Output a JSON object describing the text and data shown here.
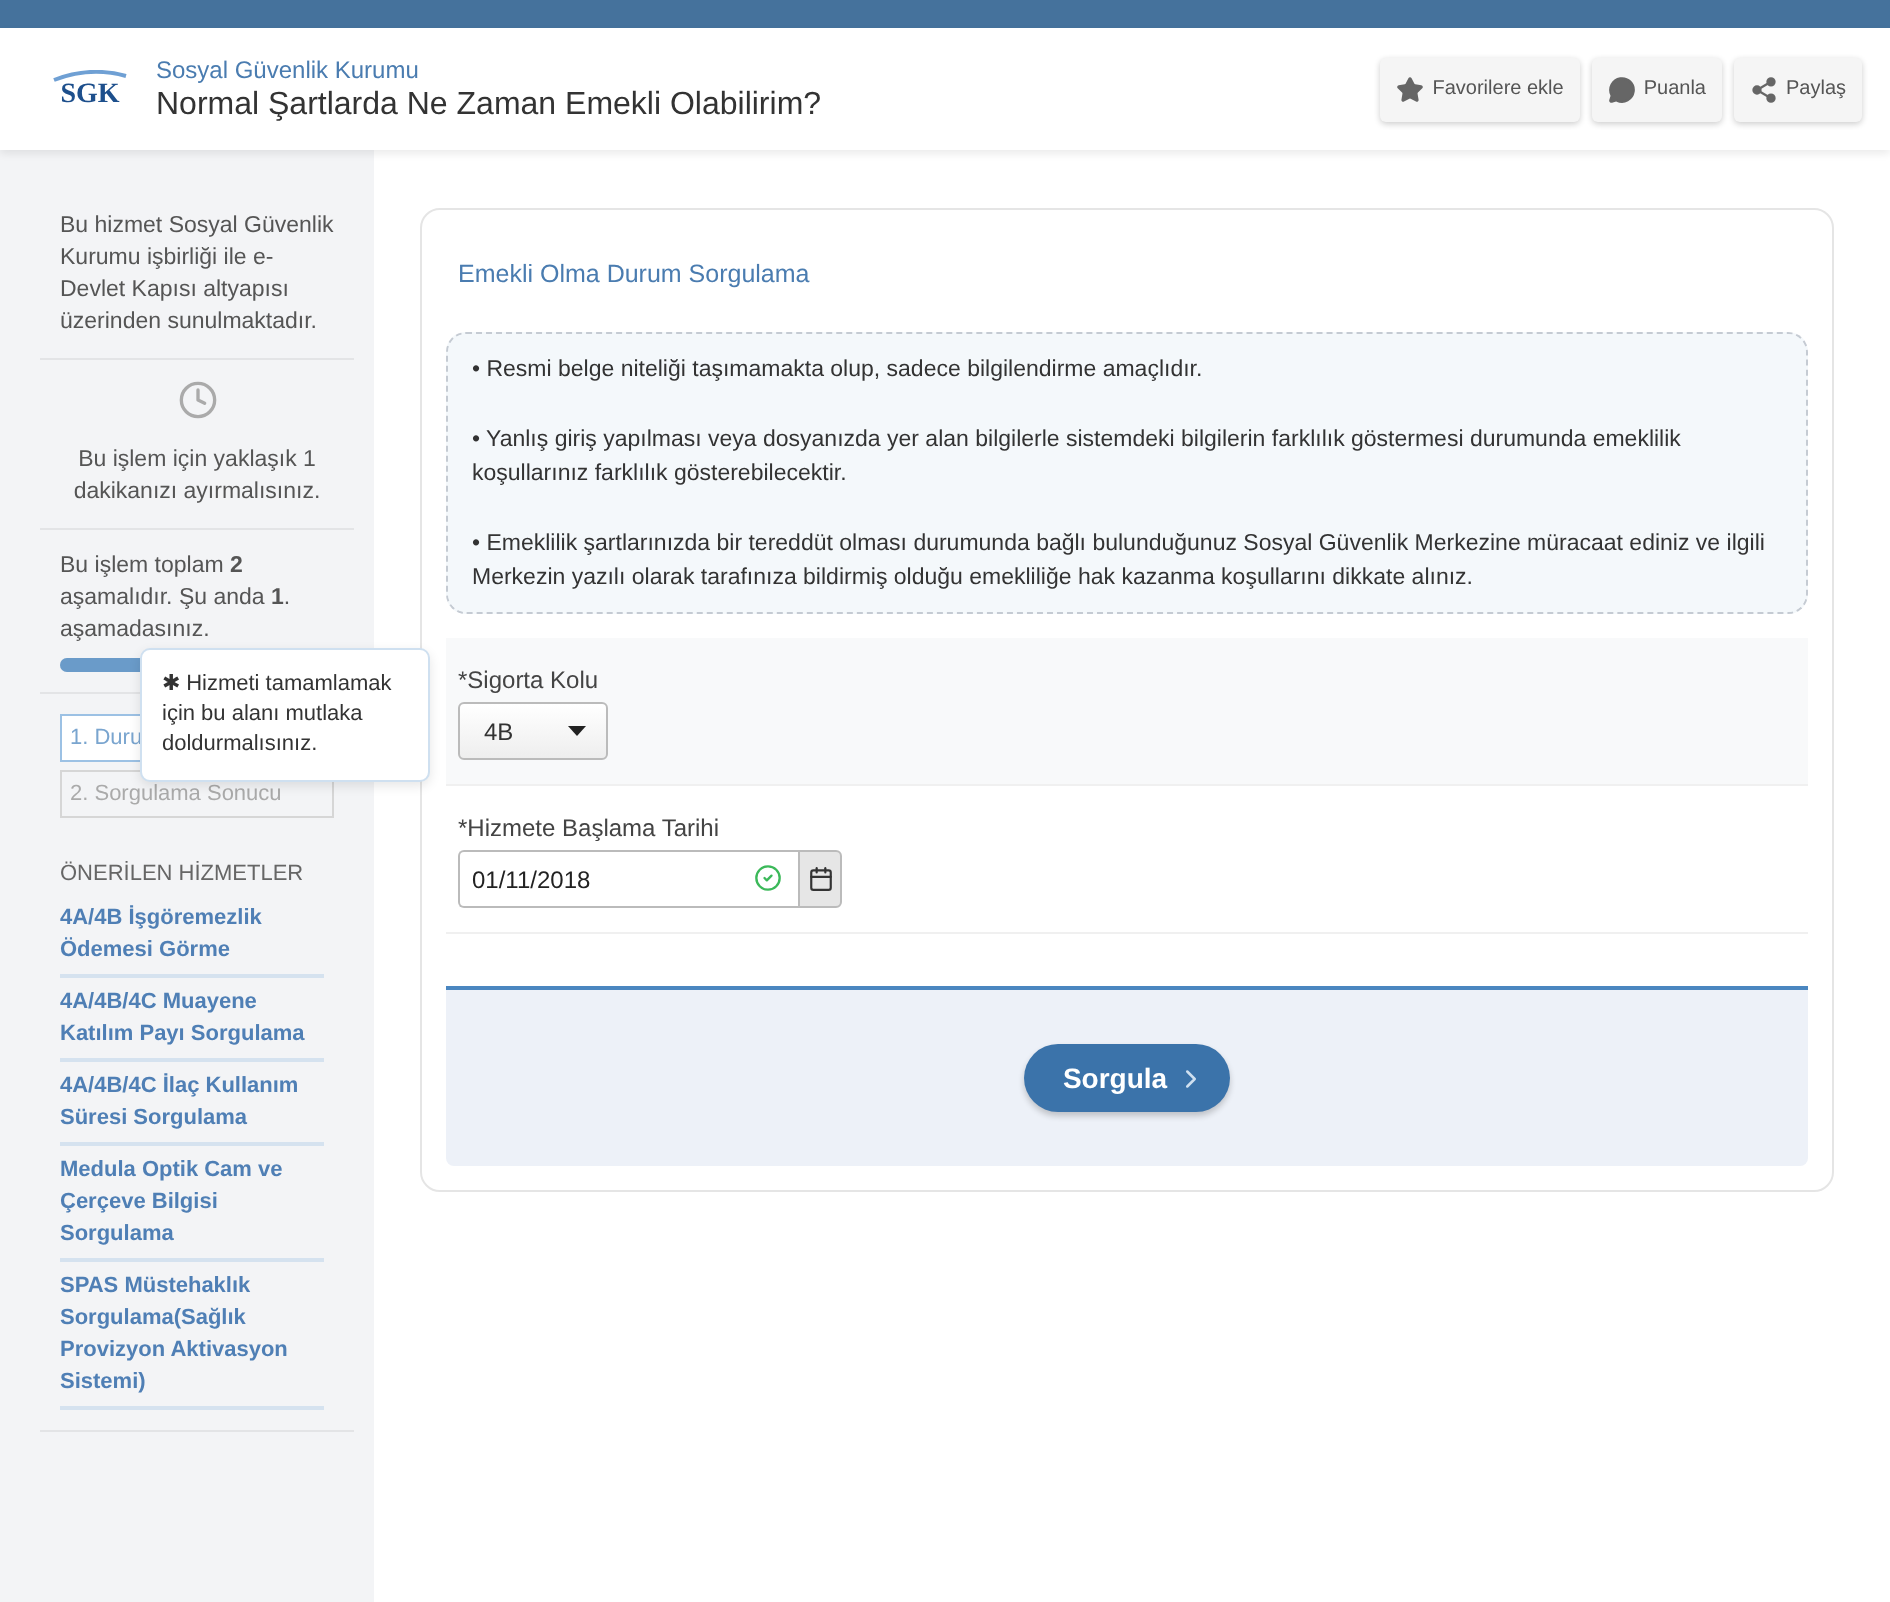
{
  "header": {
    "logo_text": "SGK",
    "agency": "Sosyal Güvenlik Kurumu",
    "title": "Normal Şartlarda Ne Zaman Emekli Olabilirim?",
    "actions": [
      {
        "kind": "star",
        "label": "Favorilere ekle"
      },
      {
        "kind": "comment",
        "label": "Puanla"
      },
      {
        "kind": "share",
        "label": "Paylaş"
      }
    ]
  },
  "sidebar": {
    "about": "Bu hizmet Sosyal Güvenlik Kurumu işbirliği ile e-Devlet Kapısı altyapısı üzerinden sunulmaktadır.",
    "duration": "Bu işlem için yaklaşık 1 dakikanızı ayırmalısınız.",
    "stages": "Bu işlem toplam **2** aşamalıdır. Şu anda **1**. aşamadasınız.",
    "progress": {
      "level": 0.5
    },
    "steps": [
      {
        "label": "1. Duru",
        "selected": true
      },
      {
        "label": "2. Sorgulama Sonucu",
        "selected": false
      }
    ],
    "recommended_title": "ÖNERİLEN HİZMETLER",
    "recommended": [
      "4A/4B İşgöremezlik Ödemesi Görme",
      "4A/4B/4C Muayene Katılım Payı Sorgulama",
      "4A/4B/4C İlaç Kullanım Süresi Sorgulama",
      "Medula Optik Cam ve Çerçeve Bilgisi Sorgulama",
      "SPAS Müstehaklık Sorgulama(Sağlık Provizyon Aktivasyon Sistemi)"
    ]
  },
  "tooltip": {
    "mark": "✱",
    "text": "Hizmeti tamamlamak için bu alanı mutlaka doldurmalısınız."
  },
  "form": {
    "title": "Emekli Olma Durum Sorgulama",
    "notes": [
      "• Resmi belge niteliği taşımamakta olup, sadece bilgilendirme amaçlıdır.",
      "• Yanlış giriş yapılması veya dosyanızda yer alan bilgilerle sistemdeki bilgilerin farklılık göstermesi durumunda emeklilik koşullarınız farklılık gösterebilecektir.",
      "• Emeklilik şartlarınızda bir tereddüt olması durumunda bağlı bulunduğunuz Sosyal Güvenlik Merkezine müracaat ediniz ve ilgili Merkezin yazılı olarak tarafınıza bildirmiş olduğu emekliliğe hak kazanma koşullarını dikkate alınız."
    ],
    "fields": [
      {
        "kind": "select",
        "label": "*Sigorta Kolu",
        "value": "4B"
      },
      {
        "kind": "date",
        "label": "*Hizmete Başlama Tarihi",
        "value": "01/11/2018",
        "valid": true
      }
    ],
    "submit": "Sorgula"
  }
}
